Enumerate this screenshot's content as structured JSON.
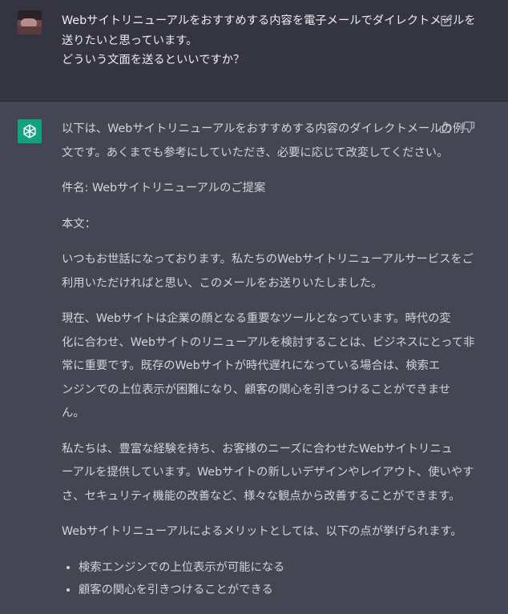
{
  "user": {
    "lines": [
      "Webサイトリニューアルをおすすめする内容を電子メールでダイレクトメールを",
      "送りたいと思っています。",
      "どういう文面を送るといいですか？"
    ]
  },
  "assistant": {
    "intro": [
      "以下は、Webサイトリニューアルをおすすめする内容のダイレクトメールの例",
      "文です。あくまでも参考にしていただき、必要に応じて改変してください。"
    ],
    "subject": "件名: Webサイトリニューアルのご提案",
    "body_label": "本文：",
    "greeting": [
      "いつもお世話になっております。私たちのWebサイトリニューアルサービスをご",
      "利用いただければと思い、このメールをお送りいたしました。"
    ],
    "paragraph1": [
      "現在、Webサイトは企業の顔となる重要なツールとなっています。時代の変",
      "化に合わせ、Webサイトのリニューアルを検討することは、ビジネスにとって非",
      "常に重要です。既存のWebサイトが時代遅れになっている場合は、検索エ",
      "ンジンでの上位表示が困難になり、顧客の関心を引きつけることができませ",
      "ん。"
    ],
    "paragraph2": [
      "私たちは、豊富な経験を持ち、お客様のニーズに合わせたWebサイトリニュ",
      "ーアルを提供しています。Webサイトの新しいデザインやレイアウト、使いやす",
      "さ、セキュリティ機能の改善など、様々な観点から改善することができます。"
    ],
    "merits_intro": "Webサイトリニューアルによるメリットとしては、以下の点が挙げられます。",
    "bullets": [
      "検索エンジンでの上位表示が可能になる",
      "顧客の関心を引きつけることができる"
    ]
  },
  "icons": {
    "edit": "edit-icon",
    "thumb_up": "thumbs-up-icon",
    "thumb_down": "thumbs-down-icon",
    "bot_logo": "openai-logo-icon"
  },
  "colors": {
    "user_bg": "#343541",
    "assistant_bg": "#444654",
    "bot_avatar": "#10a37f"
  }
}
